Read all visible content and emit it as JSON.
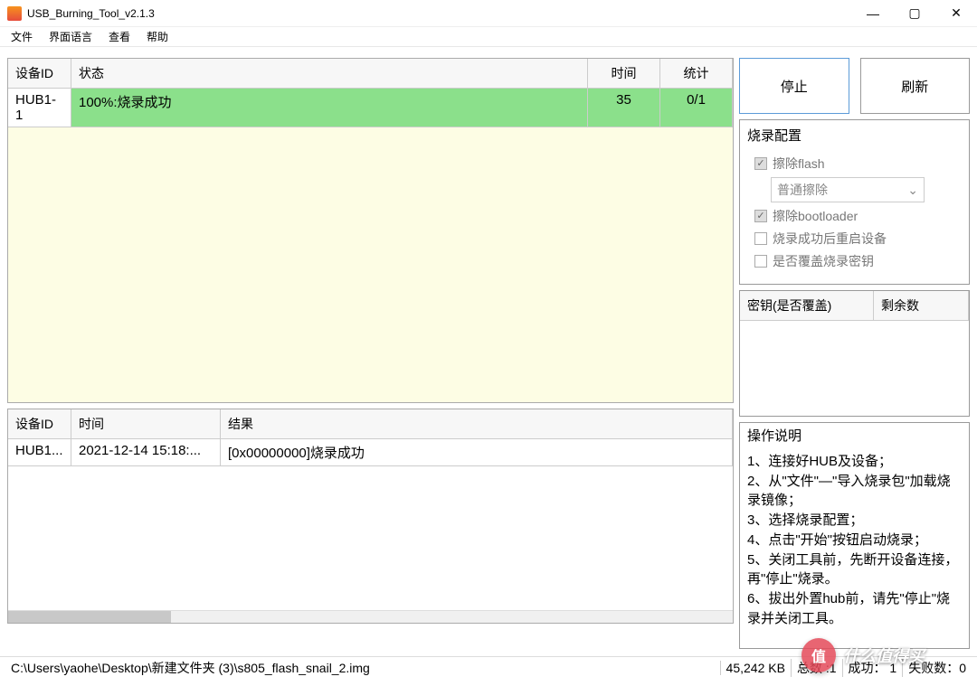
{
  "window": {
    "title": "USB_Burning_Tool_v2.1.3"
  },
  "menu": {
    "file": "文件",
    "lang": "界面语言",
    "view": "查看",
    "help": "帮助"
  },
  "grid1": {
    "headers": {
      "id": "设备ID",
      "status": "状态",
      "time": "时间",
      "stat": "统计"
    },
    "rows": [
      {
        "id": "HUB1-1",
        "status": "100%:烧录成功",
        "time": "35",
        "stat": "0/1"
      }
    ]
  },
  "grid2": {
    "headers": {
      "id": "设备ID",
      "time": "时间",
      "result": "结果"
    },
    "rows": [
      {
        "id": "HUB1...",
        "time": "2021-12-14 15:18:...",
        "result": "[0x00000000]烧录成功"
      }
    ]
  },
  "buttons": {
    "stop": "停止",
    "refresh": "刷新"
  },
  "config": {
    "title": "烧录配置",
    "erase_flash": "擦除flash",
    "erase_mode": "普通擦除",
    "erase_bootloader": "擦除bootloader",
    "restart_after": "烧录成功后重启设备",
    "overwrite_key": "是否覆盖烧录密钥"
  },
  "keygrid": {
    "headers": {
      "key": "密钥(是否覆盖)",
      "rest": "剩余数"
    }
  },
  "instructions": {
    "title": "操作说明",
    "l1": "1、连接好HUB及设备；",
    "l2": "2、从\"文件\"—\"导入烧录包\"加载烧录镜像；",
    "l3": "3、选择烧录配置；",
    "l4": "4、点击\"开始\"按钮启动烧录；",
    "l5": "5、关闭工具前，先断开设备连接，再\"停止\"烧录。",
    "l6": "6、拔出外置hub前，请先\"停止\"烧录并关闭工具。"
  },
  "statusbar": {
    "path": "C:\\Users\\yaohe\\Desktop\\新建文件夹 (3)\\s805_flash_snail_2.img",
    "size": "45,242 KB",
    "total_label": "总数 :",
    "total": "1",
    "success_label": "成功：",
    "success": "1",
    "fail_label": "失败数：",
    "fail": "0"
  },
  "watermark": {
    "badge": "值",
    "text": "什么值得买"
  }
}
